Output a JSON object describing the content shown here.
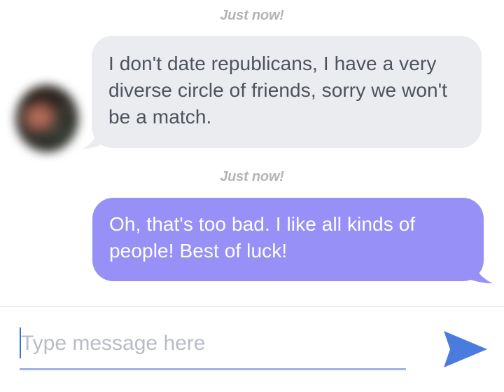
{
  "conversation": {
    "messages": [
      {
        "timestamp": "Just now!",
        "direction": "received",
        "text": "I don't date republicans, I have a very diverse circle of friends, sorry we won't be a match."
      },
      {
        "timestamp": "Just now!",
        "direction": "sent",
        "text": "Oh, that's too bad. I like all kinds of people! Best of luck!"
      }
    ]
  },
  "composer": {
    "placeholder": "Type message here",
    "value": "",
    "send_icon": "send-icon"
  },
  "colors": {
    "received_bubble": "#ebecf0",
    "sent_bubble": "#9790f6",
    "send_icon": "#4a7ce0",
    "timestamp": "#b4b4b8"
  }
}
